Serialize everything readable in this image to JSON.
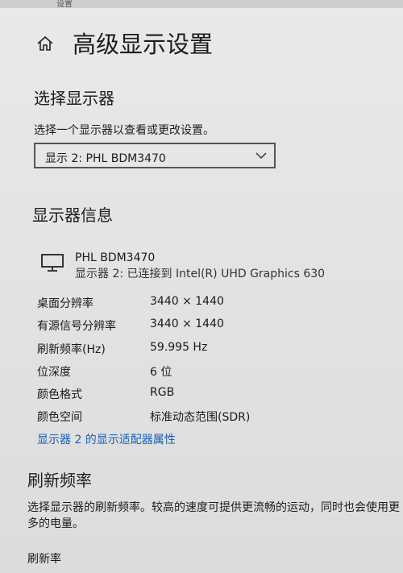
{
  "window": {
    "caption": "设置"
  },
  "page": {
    "title": "高级显示设置"
  },
  "select_display": {
    "heading": "选择显示器",
    "caption": "选择一个显示器以查看或更改设置。",
    "dropdown_value": "显示 2: PHL BDM3470"
  },
  "display_info": {
    "heading": "显示器信息",
    "monitor_name": "PHL BDM3470",
    "monitor_connection": "显示器 2: 已连接到 Intel(R) UHD Graphics 630",
    "rows": [
      {
        "key": "桌面分辨率",
        "value": "3440 × 1440"
      },
      {
        "key": "有源信号分辨率",
        "value": "3440 × 1440"
      },
      {
        "key": "刷新频率(Hz)",
        "value": "59.995 Hz"
      },
      {
        "key": "位深度",
        "value": "6 位"
      },
      {
        "key": "颜色格式",
        "value": "RGB"
      },
      {
        "key": "颜色空间",
        "value": "标准动态范围(SDR)"
      }
    ],
    "adapter_link": "显示器 2 的显示适配器属性"
  },
  "refresh_rate": {
    "heading": "刷新频率",
    "description": "选择显示器的刷新频率。较高的速度可提供更流畅的运动，同时也会使用更多的电量。",
    "label": "刷新率"
  },
  "icons": {
    "home": "home-icon",
    "chevron": "chevron-down-icon",
    "monitor": "monitor-icon"
  }
}
